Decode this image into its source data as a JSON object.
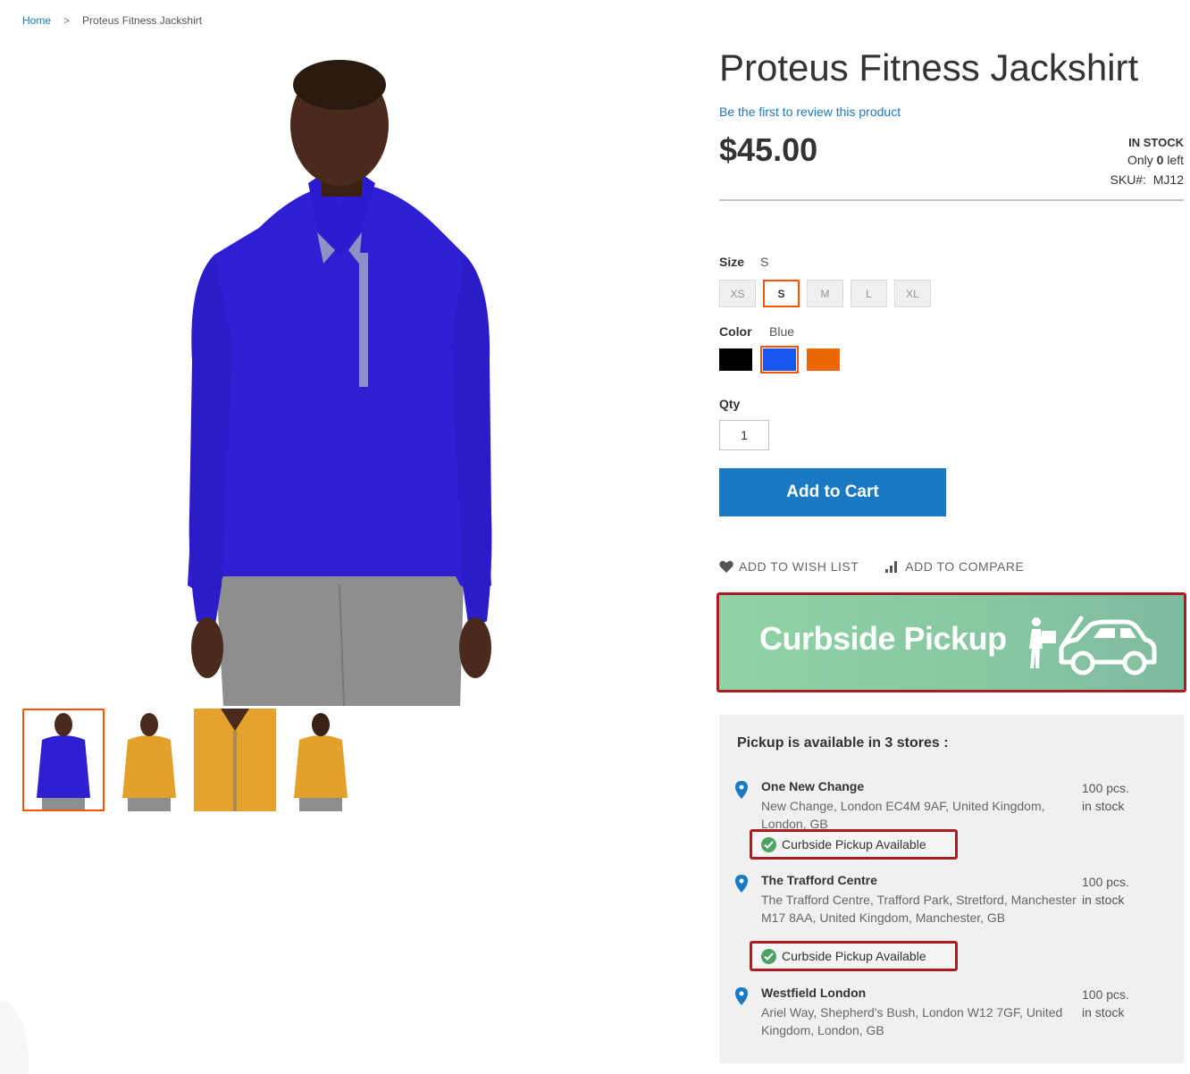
{
  "breadcrumb": {
    "home": "Home",
    "separator": ">",
    "current": "Proteus Fitness Jackshirt"
  },
  "product": {
    "title": "Proteus Fitness Jackshirt",
    "review_link": "Be the first to review this product",
    "price": "$45.00",
    "stock_status": "IN STOCK",
    "only_prefix": "Only",
    "only_count": "0",
    "only_suffix": "left",
    "sku_label": "SKU#:",
    "sku_value": "MJ12"
  },
  "size": {
    "label": "Size",
    "selected": "S",
    "options": [
      "XS",
      "S",
      "M",
      "L",
      "XL"
    ]
  },
  "color": {
    "label": "Color",
    "selected": "Blue",
    "swatches": [
      {
        "name": "Black",
        "hex": "#000000"
      },
      {
        "name": "Blue",
        "hex": "#1a56f0"
      },
      {
        "name": "Orange",
        "hex": "#eb6703"
      }
    ]
  },
  "qty": {
    "label": "Qty",
    "value": "1"
  },
  "add_to_cart": "Add to Cart",
  "actions": {
    "wishlist": "Add to Wish List",
    "compare": "Add to Compare"
  },
  "banner": {
    "text": "Curbside Pickup",
    "icon": "person-carrying-box-to-car-icon"
  },
  "pickup": {
    "title": "Pickup is available in 3 stores :",
    "stores": [
      {
        "name": "One New Change",
        "address": "New Change, London EC4M 9AF, United Kingdom, London, GB",
        "qty_line1": "100 pcs.",
        "qty_line2": "in stock",
        "badge": "Curbside Pickup Available"
      },
      {
        "name": "The Trafford Centre",
        "address": "The Trafford Centre, Trafford Park, Stretford, Manchester M17 8AA, United Kingdom, Manchester, GB",
        "qty_line1": "100 pcs.",
        "qty_line2": "in stock",
        "badge": "Curbside Pickup Available"
      },
      {
        "name": "Westfield London",
        "address": "Ariel Way, Shepherd's Bush, London W12 7GF, United Kingdom, London, GB",
        "qty_line1": "100 pcs.",
        "qty_line2": "in stock"
      }
    ]
  },
  "colors": {
    "link": "#1979c3",
    "primary_button": "#1979c3",
    "highlight_border": "#a91d22",
    "selected_outline": "#ff5501",
    "check_green": "#4da365"
  }
}
